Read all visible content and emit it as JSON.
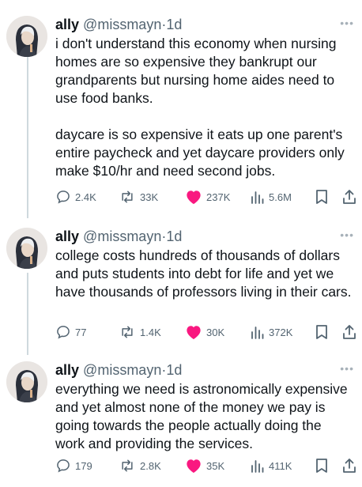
{
  "colors": {
    "text": "#0f1419",
    "muted": "#536471",
    "like": "#f91880",
    "thread_line": "#cfd9de"
  },
  "tweets": [
    {
      "name": "ally",
      "handle": "@missmayn",
      "separator": "·",
      "time": "1d",
      "paragraphs": [
        "i don't understand this economy when nursing homes are so expensive they bankrupt our grandparents but nursing home aides need to use food banks.",
        "daycare is so expensive it eats up one parent's entire paycheck and yet daycare providers only make $10/hr and need second jobs."
      ],
      "replies": "2.4K",
      "retweets": "33K",
      "likes": "237K",
      "views": "5.6M"
    },
    {
      "name": "ally",
      "handle": "@missmayn",
      "separator": "·",
      "time": "1d",
      "paragraphs": [
        "college costs hundreds of thousands of dollars and puts students into debt for life and yet we have thousands of professors living in their cars."
      ],
      "replies": "77",
      "retweets": "1.4K",
      "likes": "30K",
      "views": "372K"
    },
    {
      "name": "ally",
      "handle": "@missmayn",
      "separator": "·",
      "time": "1d",
      "paragraphs": [
        "everything we need is astronomically expensive and yet almost none of the money we pay is going towards the people actually doing the work and providing the services."
      ],
      "replies": "179",
      "retweets": "2.8K",
      "likes": "35K",
      "views": "411K"
    }
  ],
  "icons": {
    "more": "more-dots-icon",
    "reply": "reply-bubble-icon",
    "retweet": "retweet-arrows-icon",
    "like": "heart-filled-icon",
    "views": "bar-chart-icon",
    "bookmark": "bookmark-icon",
    "share": "share-upload-icon"
  }
}
